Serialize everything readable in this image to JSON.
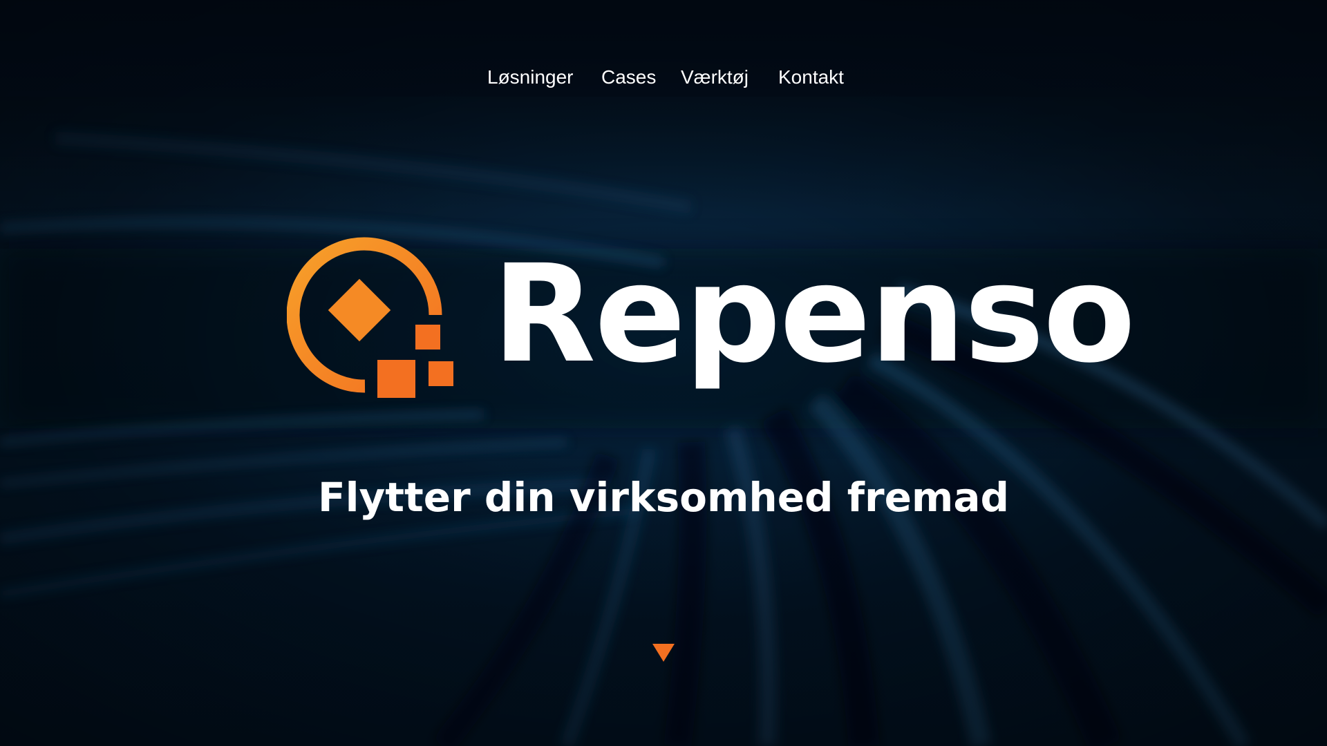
{
  "nav": {
    "items": [
      {
        "label": "Løsninger"
      },
      {
        "label": "Cases"
      },
      {
        "label": "Værktøj"
      },
      {
        "label": "Kontakt"
      }
    ]
  },
  "brand": {
    "name": "Repenso",
    "tagline": "Flytter din virksomhed fremad",
    "accent_color": "#f37021",
    "accent_light": "#f7941d",
    "logo_icon": "repenso-logo-icon"
  },
  "scroll": {
    "icon": "triangle-down-icon"
  }
}
